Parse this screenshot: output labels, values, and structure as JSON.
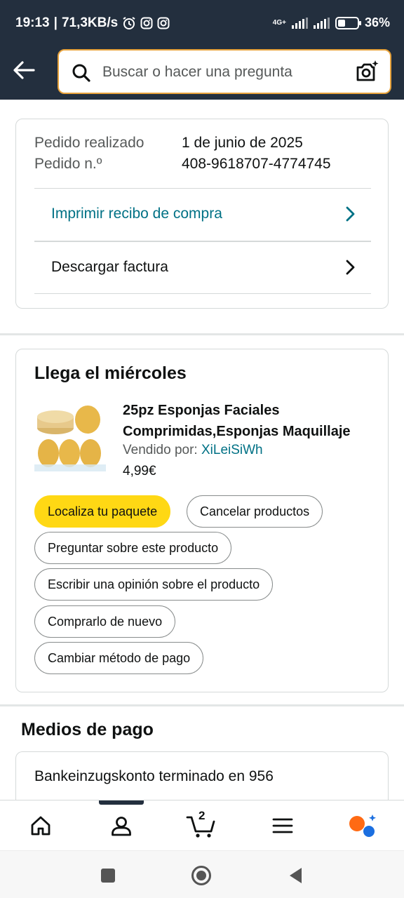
{
  "status_bar": {
    "time": "19:13",
    "speed": "71,3KB/s",
    "network": "4G+",
    "battery": "36%"
  },
  "header": {
    "search_placeholder": "Buscar o hacer una pregunta"
  },
  "order": {
    "placed_label": "Pedido realizado",
    "placed_value": "1 de junio de 2025",
    "number_label": "Pedido n.º",
    "number_value": "408-9618707-4774745",
    "print_receipt": "Imprimir recibo de compra",
    "download_invoice": "Descargar factura"
  },
  "shipment": {
    "heading": "Llega el miércoles",
    "product_title_line1": "25pz Esponjas Faciales",
    "product_title_line2": "Comprimidas,Esponjas Maquillaje",
    "seller_label": "Vendido por:",
    "seller_name": "XiLeiSiWh",
    "price": "4,99€",
    "actions": {
      "track": "Localiza tu paquete",
      "cancel": "Cancelar productos",
      "ask": "Preguntar sobre este producto",
      "review": "Escribir una opinión sobre el producto",
      "buy_again": "Comprarlo de nuevo",
      "change_payment": "Cambiar método de pago"
    }
  },
  "payment": {
    "heading": "Medios de pago",
    "method": "Bankeinzugskonto terminado en 956"
  },
  "bottom_nav": {
    "cart_count": "2"
  },
  "colors": {
    "header_bg": "#232f3e",
    "link": "#007185",
    "primary_button": "#ffd814",
    "search_border": "#e7a23b"
  }
}
